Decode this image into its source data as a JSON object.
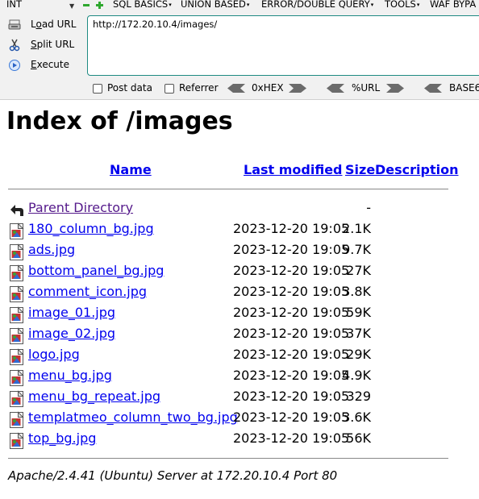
{
  "hackbar": {
    "select_value": "INT",
    "menus": [
      "SQL BASICS",
      "UNION BASED",
      "ERROR/DOUBLE QUERY",
      "TOOLS",
      "WAF BYPA"
    ],
    "side_buttons": [
      {
        "label": "Load URL",
        "icon": "load-url-icon"
      },
      {
        "label": "Split URL",
        "icon": "scissors-icon"
      },
      {
        "label": "Execute",
        "icon": "execute-icon"
      }
    ],
    "url_value": "http://172.20.10.4/images/",
    "options": {
      "post_data": "Post data",
      "referrer": "Referrer"
    },
    "encoders": [
      "0xHEX",
      "%URL",
      "BASE6"
    ],
    "accent": "#1e8a82"
  },
  "index": {
    "title": "Index of /images",
    "columns": {
      "name": "Name",
      "last_modified": "Last modified",
      "size": "Size",
      "description": "Description"
    },
    "parent": {
      "name": "Parent Directory",
      "size": "-"
    },
    "files": [
      {
        "name": "180_column_bg.jpg",
        "date": "2023-12-20 19:05",
        "size": "2.1K"
      },
      {
        "name": "ads.jpg",
        "date": "2023-12-20 19:05",
        "size": "9.7K"
      },
      {
        "name": "bottom_panel_bg.jpg",
        "date": "2023-12-20 19:05",
        "size": "27K"
      },
      {
        "name": "comment_icon.jpg",
        "date": "2023-12-20 19:05",
        "size": "3.8K"
      },
      {
        "name": "image_01.jpg",
        "date": "2023-12-20 19:05",
        "size": "59K"
      },
      {
        "name": "image_02.jpg",
        "date": "2023-12-20 19:05",
        "size": "37K"
      },
      {
        "name": "logo.jpg",
        "date": "2023-12-20 19:05",
        "size": "29K"
      },
      {
        "name": "menu_bg.jpg",
        "date": "2023-12-20 19:05",
        "size": "4.9K"
      },
      {
        "name": "menu_bg_repeat.jpg",
        "date": "2023-12-20 19:05",
        "size": "329"
      },
      {
        "name": "templatmeo_column_two_bg.jpg",
        "date": "2023-12-20 19:05",
        "size": "3.6K"
      },
      {
        "name": "top_bg.jpg",
        "date": "2023-12-20 19:05",
        "size": "56K"
      }
    ],
    "address": "Apache/2.4.41 (Ubuntu) Server at 172.20.10.4 Port 80",
    "link_color": "#0000ee",
    "visited_color": "#551a8b"
  }
}
